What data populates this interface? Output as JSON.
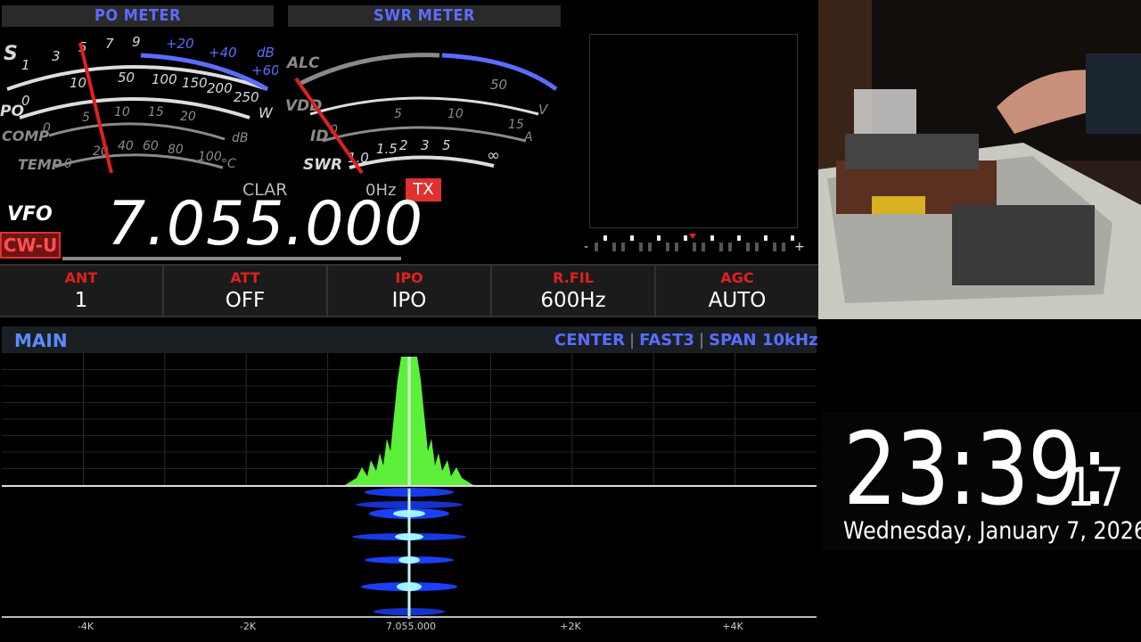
{
  "po_meter": {
    "title": "PO METER",
    "labels": {
      "s": "S",
      "po": "PO",
      "comp": "COMP",
      "temp": "TEMP"
    },
    "s_scale": [
      "1",
      "3",
      "5",
      "7",
      "9"
    ],
    "s_plus_scale": [
      "+20",
      "+40",
      "+60"
    ],
    "s_plus_unit": "dB",
    "po_scale": [
      "0",
      "10",
      "50",
      "100",
      "150",
      "200",
      "250"
    ],
    "po_unit": "W",
    "comp_scale": [
      "0",
      "5",
      "10",
      "15",
      "20"
    ],
    "comp_unit": "dB",
    "temp_scale": [
      "0",
      "20",
      "40",
      "60",
      "80",
      "100"
    ],
    "temp_unit": "°C"
  },
  "swr_meter": {
    "title": "SWR METER",
    "labels": {
      "alc": "ALC",
      "vdd": "VDD",
      "id": "ID",
      "swr": "SWR"
    },
    "vdd_scale": [
      "50"
    ],
    "vdd_unit": "V",
    "id_scale": [
      "0",
      "5",
      "10",
      "15"
    ],
    "id_unit": "A",
    "swr_scale": [
      "1.0",
      "1.5",
      "2",
      "3",
      "5",
      "∞"
    ]
  },
  "clar": {
    "label": "CLAR",
    "value": "0Hz"
  },
  "tx_badge": "TX",
  "vfo": {
    "label": "VFO",
    "mode": "CW-U",
    "frequency": "7.055.000"
  },
  "functions": [
    {
      "title": "ANT",
      "value": "1"
    },
    {
      "title": "ATT",
      "value": "OFF"
    },
    {
      "title": "IPO",
      "value": "IPO"
    },
    {
      "title": "R.FIL",
      "value": "600Hz"
    },
    {
      "title": "AGC",
      "value": "AUTO"
    }
  ],
  "spectrum": {
    "label": "MAIN",
    "options": [
      "CENTER",
      "FAST3",
      "SPAN"
    ],
    "span": "10kHz",
    "axis_ticks": [
      "-4K",
      "-2K",
      "7.055.000",
      "+2K",
      "+4K"
    ]
  },
  "tuning_scale": {
    "minus": "-",
    "plus": "+"
  },
  "clock": {
    "hours_minutes": "23:39:",
    "seconds": "17",
    "date": "Wednesday, January 7, 2026"
  },
  "colors": {
    "accent_blue": "#5b6cff",
    "alert_red": "#e02020",
    "spectrum_green": "#5cf03a",
    "waterfall_blue": "#1a40ff"
  }
}
